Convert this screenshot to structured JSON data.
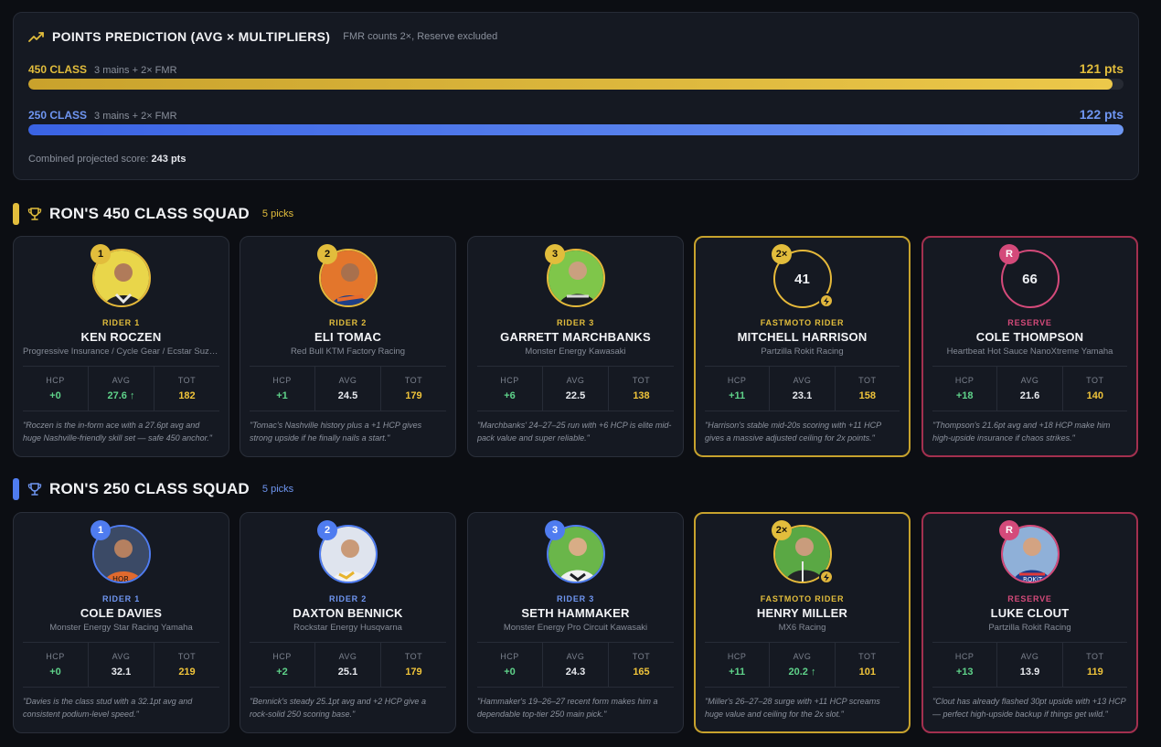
{
  "prediction": {
    "title": "POINTS PREDICTION (AVG × MULTIPLIERS)",
    "note": "FMR counts 2×, Reserve excluded",
    "classes": [
      {
        "name": "450 CLASS",
        "sub": "3 mains + 2× FMR",
        "pts": "121 pts",
        "fill": 0.99,
        "color": "#e2bd3c"
      },
      {
        "name": "250 CLASS",
        "sub": "3 mains + 2× FMR",
        "pts": "122 pts",
        "fill": 1.0,
        "color": "#4f7cf0"
      }
    ],
    "combined_label": "Combined projected score:",
    "combined_value": "243 pts"
  },
  "squads": [
    {
      "title": "RON'S 450 CLASS SQUAD",
      "count": "5 picks",
      "accent": "#e2bd3c",
      "riders": [
        {
          "badge": "1",
          "role": "RIDER 1",
          "name": "KEN ROCZEN",
          "team": "Progressive Insurance / Cycle Gear / Ecstar Suzuki",
          "hcp": "+0",
          "avg": "27.6 ↑",
          "tot": "182",
          "quote": "\"Roczen is the in-form ace with a 27.6pt avg and huge Nashville-friendly skill set — safe 450 anchor.\""
        },
        {
          "badge": "2",
          "role": "RIDER 2",
          "name": "ELI TOMAC",
          "team": "Red Bull KTM Factory Racing",
          "hcp": "+1",
          "avg": "24.5",
          "tot": "179",
          "quote": "\"Tomac's Nashville history plus a +1 HCP gives strong upside if he finally nails a start.\""
        },
        {
          "badge": "3",
          "role": "RIDER 3",
          "name": "GARRETT MARCHBANKS",
          "team": "Monster Energy Kawasaki",
          "hcp": "+6",
          "avg": "22.5",
          "tot": "138",
          "quote": "\"Marchbanks' 24–27–25 run with +6 HCP is elite mid-pack value and super reliable.\""
        },
        {
          "badge": "2×",
          "role": "FASTMOTO RIDER",
          "name": "MITCHELL HARRISON",
          "team": "Partzilla Rokit Racing",
          "hcp": "+11",
          "avg": "23.1",
          "tot": "158",
          "number": "41",
          "quote": "\"Harrison's stable mid-20s scoring with +11 HCP gives a massive adjusted ceiling for 2x points.\""
        },
        {
          "badge": "R",
          "role": "RESERVE",
          "name": "COLE THOMPSON",
          "team": "Heartbeat Hot Sauce NanoXtreme Yamaha",
          "hcp": "+18",
          "avg": "21.6",
          "tot": "140",
          "number": "66",
          "quote": "\"Thompson's 21.6pt avg and +18 HCP make him high-upside insurance if chaos strikes.\""
        }
      ]
    },
    {
      "title": "RON'S 250 CLASS SQUAD",
      "count": "5 picks",
      "accent": "#4f7cf0",
      "riders": [
        {
          "badge": "1",
          "role": "RIDER 1",
          "name": "COLE DAVIES",
          "team": "Monster Energy Star Racing Yamaha",
          "hcp": "+0",
          "avg": "32.1",
          "tot": "219",
          "quote": "\"Davies is the class stud with a 32.1pt avg and consistent podium-level speed.\""
        },
        {
          "badge": "2",
          "role": "RIDER 2",
          "name": "DAXTON BENNICK",
          "team": "Rockstar Energy Husqvarna",
          "hcp": "+2",
          "avg": "25.1",
          "tot": "179",
          "quote": "\"Bennick's steady 25.1pt avg and +2 HCP give a rock-solid 250 scoring base.\""
        },
        {
          "badge": "3",
          "role": "RIDER 3",
          "name": "SETH HAMMAKER",
          "team": "Monster Energy Pro Circuit Kawasaki",
          "hcp": "+0",
          "avg": "24.3",
          "tot": "165",
          "quote": "\"Hammaker's 19–26–27 recent form makes him a dependable top-tier 250 main pick.\""
        },
        {
          "badge": "2×",
          "role": "FASTMOTO RIDER",
          "name": "HENRY MILLER",
          "team": "MX6 Racing",
          "hcp": "+11",
          "avg": "20.2 ↑",
          "tot": "101",
          "quote": "\"Miller's 26–27–28 surge with +11 HCP screams huge value and ceiling for the 2x slot.\""
        },
        {
          "badge": "R",
          "role": "RESERVE",
          "name": "LUKE CLOUT",
          "team": "Partzilla Rokit Racing",
          "hcp": "+13",
          "avg": "13.9",
          "tot": "119",
          "quote": "\"Clout has already flashed 30pt upside with +13 HCP — perfect high-upside backup if things get wild.\""
        }
      ]
    }
  ],
  "stat_labels": {
    "hcp": "HCP",
    "avg": "AVG",
    "tot": "TOT"
  },
  "colors": {
    "gold": "#e2bd3c",
    "blue": "#4f7cf0",
    "pink": "#d44a7a",
    "green": "#5fd38a"
  }
}
